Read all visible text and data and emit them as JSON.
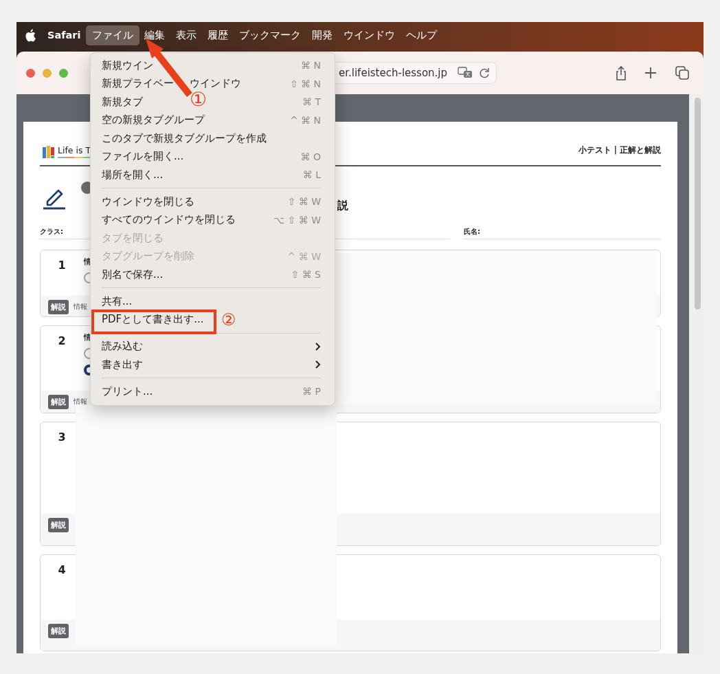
{
  "menu_bar": {
    "app_name": "Safari",
    "items": [
      {
        "label": "ファイル",
        "selected": true
      },
      {
        "label": "編集",
        "selected": false
      },
      {
        "label": "表示",
        "selected": false
      },
      {
        "label": "履歴",
        "selected": false
      },
      {
        "label": "ブックマーク",
        "selected": false
      },
      {
        "label": "開発",
        "selected": false
      },
      {
        "label": "ウインドウ",
        "selected": false
      },
      {
        "label": "ヘルプ",
        "selected": false
      }
    ]
  },
  "browser": {
    "address": "er.lifeistech-lesson.jp"
  },
  "file_menu": {
    "items": [
      {
        "kind": "item",
        "label": "新規ウイン",
        "shortcut": "⌘ N",
        "disabled": false
      },
      {
        "kind": "item",
        "label": "新規プライベー",
        "label_rest": "ウインドウ",
        "shortcut": "⇧ ⌘ N",
        "disabled": false
      },
      {
        "kind": "item",
        "label": "新規タブ",
        "shortcut": "⌘ T",
        "disabled": false
      },
      {
        "kind": "item",
        "label": "空の新規タブグループ",
        "shortcut": "^ ⌘ N",
        "disabled": false
      },
      {
        "kind": "item",
        "label": "このタブで新規タブグループを作成",
        "disabled": false
      },
      {
        "kind": "item",
        "label": "ファイルを開く...",
        "shortcut": "⌘ O",
        "disabled": false
      },
      {
        "kind": "item",
        "label": "場所を開く...",
        "shortcut": "⌘ L",
        "disabled": false
      },
      {
        "kind": "separator"
      },
      {
        "kind": "item",
        "label": "ウインドウを閉じる",
        "shortcut": "⇧ ⌘ W",
        "disabled": false
      },
      {
        "kind": "item",
        "label": "すべてのウインドウを閉じる",
        "shortcut": "⌥ ⇧ ⌘ W",
        "disabled": false
      },
      {
        "kind": "item",
        "label": "タブを閉じる",
        "disabled": true
      },
      {
        "kind": "item",
        "label": "タブグループを削除",
        "shortcut": "^ ⌘ W",
        "disabled": true
      },
      {
        "kind": "item",
        "label": "別名で保存...",
        "shortcut": "⇧ ⌘ S",
        "disabled": false
      },
      {
        "kind": "separator"
      },
      {
        "kind": "item",
        "label": "共有...",
        "disabled": false
      },
      {
        "kind": "item",
        "label": "PDFとして書き出す...",
        "disabled": false,
        "boxed": true,
        "note": "②"
      },
      {
        "kind": "separator"
      },
      {
        "kind": "submenu",
        "label": "読み込む",
        "disabled": false
      },
      {
        "kind": "submenu",
        "label": "書き出す",
        "disabled": false
      },
      {
        "kind": "separator"
      },
      {
        "kind": "item",
        "label": "プリント...",
        "shortcut": "⌘ P",
        "disabled": false
      }
    ]
  },
  "annotations": {
    "arrow": true,
    "marker": "①"
  },
  "page": {
    "logo_text": "Life is T",
    "header_title": "小テスト | 正解と解説",
    "title_fragment": "説",
    "class_label": "クラス:",
    "name_label": "氏名:",
    "redacted": true,
    "questions": [
      {
        "number": "1",
        "text": "情",
        "options": [
          {
            "selected": false
          }
        ],
        "badge": "解説",
        "explanation": "情報"
      },
      {
        "number": "2",
        "text": "情",
        "options": [
          {
            "selected": false
          },
          {
            "selected": true
          }
        ],
        "badge": "解説",
        "explanation": "情報"
      },
      {
        "number": "3",
        "badge": "解説"
      },
      {
        "number": "4",
        "badge": "解説"
      }
    ]
  }
}
